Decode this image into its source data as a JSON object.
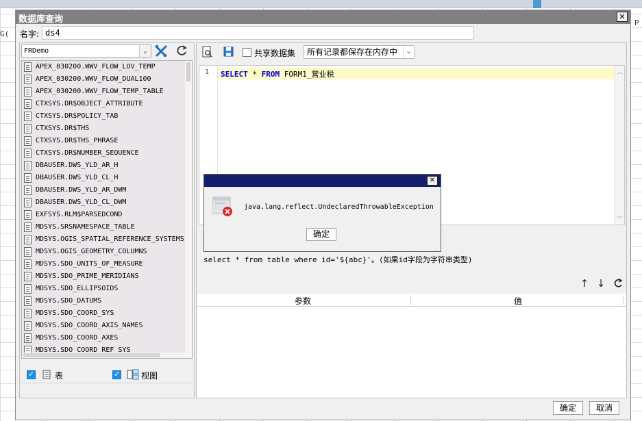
{
  "background": {
    "left_cell_text": "G(",
    "right_cell_text": "P"
  },
  "dialog": {
    "title": "数据库查询",
    "close_glyph": "✕",
    "name_label": "名字:",
    "name_value": "ds4"
  },
  "left_panel": {
    "database": "FRDemo",
    "tables": [
      "APEX_030200.WWV_FLOW_LOV_TEMP",
      "APEX_030200.WWV_FLOW_DUAL100",
      "APEX_030200.WWV_FLOW_TEMP_TABLE",
      "CTXSYS.DR$OBJECT_ATTRIBUTE",
      "CTXSYS.DR$POLICY_TAB",
      "CTXSYS.DR$THS",
      "CTXSYS.DR$THS_PHRASE",
      "CTXSYS.DR$NUMBER_SEQUENCE",
      "DBAUSER.DWS_YLD_AR_H",
      "DBAUSER.DWS_YLD_CL_H",
      "DBAUSER.DWS_YLD_AR_DWM",
      "DBAUSER.DWS_YLD_CL_DWM",
      "EXFSYS.RLM$PARSEDCOND",
      "MDSYS.SRSNAMESPACE_TABLE",
      "MDSYS.OGIS_SPATIAL_REFERENCE_SYSTEMS",
      "MDSYS.OGIS_GEOMETRY_COLUMNS",
      "MDSYS.SDO_UNITS_OF_MEASURE",
      "MDSYS.SDO_PRIME_MERIDIANS",
      "MDSYS.SDO_ELLIPSOIDS",
      "MDSYS.SDO_DATUMS",
      "MDSYS.SDO_COORD_SYS",
      "MDSYS.SDO_COORD_AXIS_NAMES",
      "MDSYS.SDO_COORD_AXES",
      "MDSYS.SDO_COORD_REF_SYS"
    ],
    "show_tables_label": "表",
    "show_tables_checked": true,
    "show_views_label": "视图",
    "show_views_checked": true
  },
  "right_panel": {
    "share_label": "共享数据集",
    "share_checked": false,
    "mode_value": "所有记录都保存在内存中",
    "line_number": "1",
    "sql_kw1": "SELECT",
    "sql_mid1": " * ",
    "sql_kw2": "FROM",
    "sql_tail": " FORM1_营业税",
    "hint": "select * from table where id='${abc}'。(如果id字段为字符串类型)",
    "param_col": "参数",
    "value_col": "值"
  },
  "error": {
    "message": "java.lang.reflect.UndeclaredThrowableException",
    "ok_label": "确定",
    "close_glyph": "✕"
  },
  "footer": {
    "ok_label": "确定",
    "cancel_label": "取消"
  },
  "colors": {
    "error_titlebar": "#15206d",
    "checkbox_accent": "#1e90e8",
    "sql_keyword": "#0000dd",
    "current_line": "#fdfbc8"
  }
}
